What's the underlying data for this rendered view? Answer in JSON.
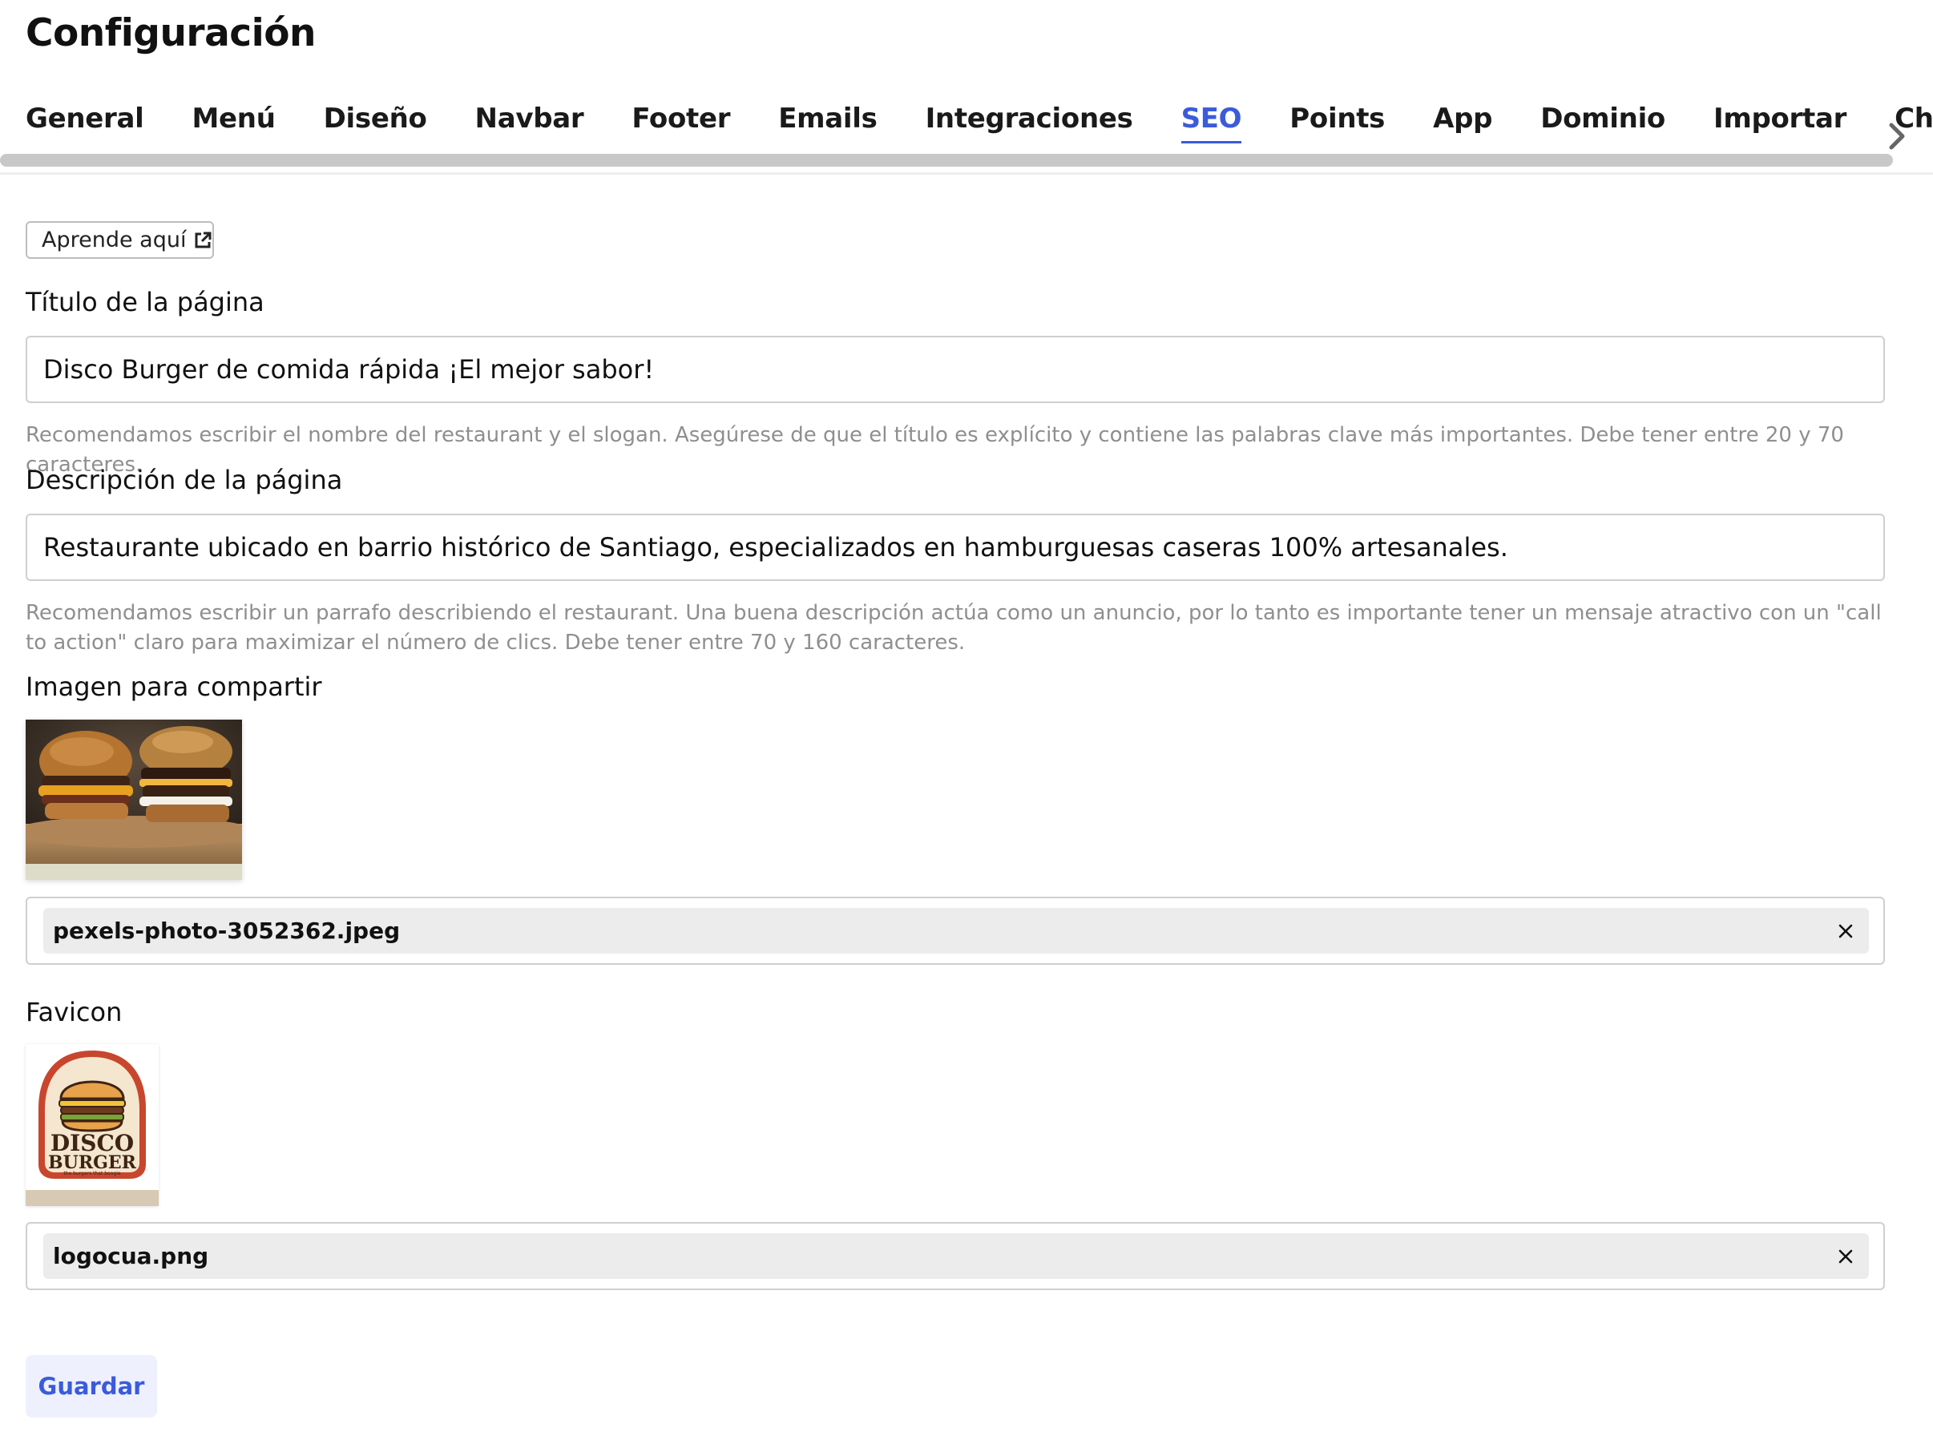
{
  "page": {
    "title": "Configuración"
  },
  "tabs": [
    {
      "label": "General",
      "active": false
    },
    {
      "label": "Menú",
      "active": false
    },
    {
      "label": "Diseño",
      "active": false
    },
    {
      "label": "Navbar",
      "active": false
    },
    {
      "label": "Footer",
      "active": false
    },
    {
      "label": "Emails",
      "active": false
    },
    {
      "label": "Integraciones",
      "active": false
    },
    {
      "label": "SEO",
      "active": true
    },
    {
      "label": "Points",
      "active": false
    },
    {
      "label": "App",
      "active": false
    },
    {
      "label": "Dominio",
      "active": false
    },
    {
      "label": "Importar",
      "active": false
    },
    {
      "label": "Chatbot",
      "active": false
    }
  ],
  "learn": {
    "label": "Aprende aquí"
  },
  "seo": {
    "title_label": "Título de la página",
    "title_value": "Disco Burger de comida rápida ¡El mejor sabor!",
    "title_help": "Recomendamos escribir el nombre del restaurant y el slogan. Asegúrese de que el título es explícito y contiene las palabras clave más importantes. Debe tener entre 20 y 70 caracteres.",
    "description_label": "Descripción de la página",
    "description_value": "Restaurante ubicado en barrio histórico de Santiago, especializados en hamburguesas caseras 100% artesanales.",
    "description_help": "Recomendamos escribir un parrafo describiendo el restaurant. Una buena descripción actúa como un anuncio, por lo tanto es importante tener un mensaje atractivo con un \"call to action\" claro para maximizar el número de clics. Debe tener entre 70 y 160 caracteres.",
    "share_image_label": "Imagen para compartir",
    "share_image_file": "pexels-photo-3052362.jpeg",
    "favicon_label": "Favicon",
    "favicon_file": "logocua.png",
    "favicon_logo_line1": "DISCO",
    "favicon_logo_line2": "BURGER",
    "favicon_logo_tagline": "the burgers that boogie"
  },
  "actions": {
    "save_label": "Guardar"
  },
  "colors": {
    "accent": "#3b5bdb",
    "help_text": "#8f8f8f",
    "save_bg": "#eef1fd"
  },
  "icons": {
    "external": "external-link-icon",
    "next": "chevron-right-icon",
    "remove": "close-icon"
  }
}
